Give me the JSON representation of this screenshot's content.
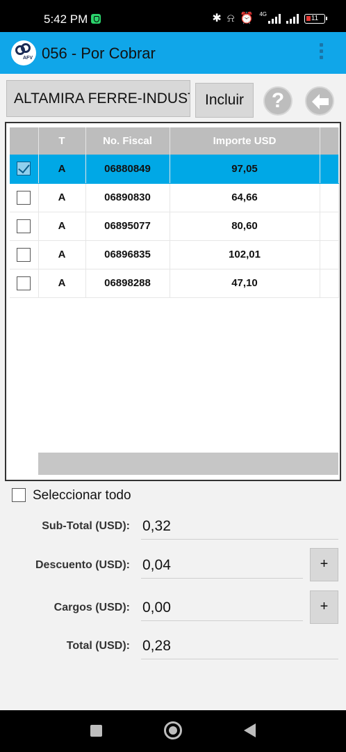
{
  "status_bar": {
    "time": "5:42 PM",
    "network_label": "4G",
    "battery_level": "11",
    "icons": [
      "shield-icon",
      "bluetooth-icon",
      "mute-icon",
      "alarm-icon",
      "signal-icon",
      "signal-icon",
      "battery-icon"
    ]
  },
  "app_bar": {
    "title": "056 - Por Cobrar",
    "logo_text": "AFV",
    "accent_color": "#10a6e9"
  },
  "toolbar": {
    "client_name": "ALTAMIRA FERRE-INDUSTRIAL",
    "include_label": "Incluir",
    "help_glyph": "?"
  },
  "table": {
    "headers": [
      "",
      "T",
      "No. Fiscal",
      "Importe USD"
    ],
    "rows": [
      {
        "checked": true,
        "tipo": "A",
        "fiscal": "06880849",
        "importe": "97,05"
      },
      {
        "checked": false,
        "tipo": "A",
        "fiscal": "06890830",
        "importe": "64,66"
      },
      {
        "checked": false,
        "tipo": "A",
        "fiscal": "06895077",
        "importe": "80,60"
      },
      {
        "checked": false,
        "tipo": "A",
        "fiscal": "06896835",
        "importe": "102,01"
      },
      {
        "checked": false,
        "tipo": "A",
        "fiscal": "06898288",
        "importe": "47,10"
      }
    ],
    "selected_row_color": "#00a8e6"
  },
  "select_all": {
    "label": "Seleccionar todo",
    "checked": false
  },
  "totals": {
    "subtotal_label": "Sub-Total (USD):",
    "subtotal_value": "0,32",
    "discount_label": "Descuento (USD):",
    "discount_value": "0,04",
    "charges_label": "Cargos (USD):",
    "charges_value": "0,00",
    "total_label": "Total (USD):",
    "total_value": "0,28",
    "plus_label": "+"
  }
}
